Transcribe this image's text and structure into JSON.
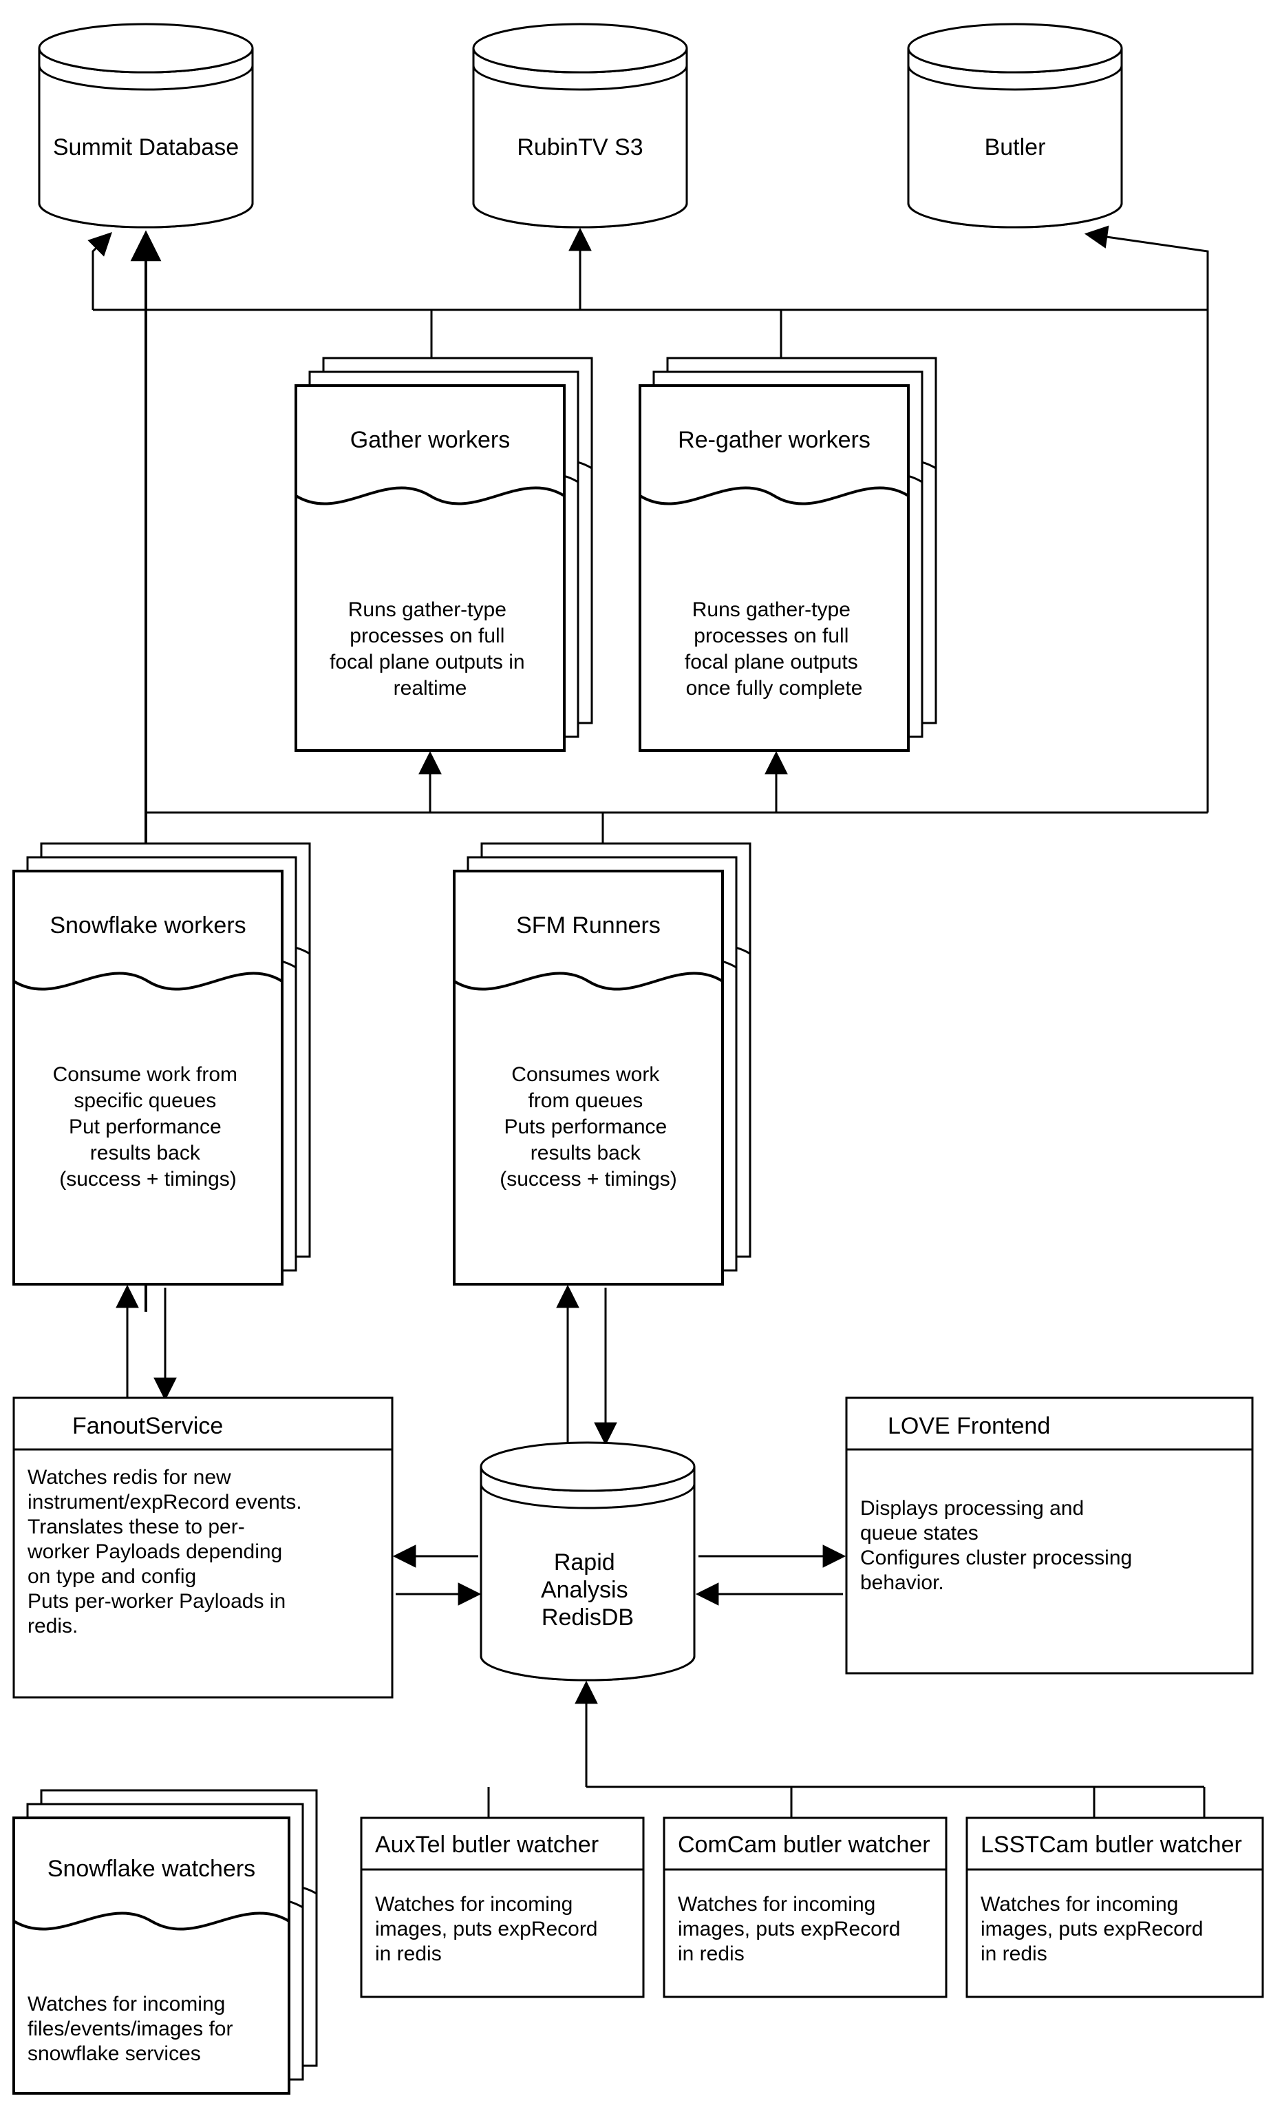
{
  "dbs": {
    "summit": "Summit Database",
    "rubin": "RubinTV S3",
    "butler": "Butler",
    "redis": [
      "Rapid",
      "Analysis",
      "RedisDB"
    ]
  },
  "stacks": {
    "gather": {
      "title": "Gather workers",
      "desc": [
        "Runs gather-type",
        "processes on full",
        "focal plane outputs in",
        "realtime"
      ]
    },
    "regather": {
      "title": "Re-gather workers",
      "desc": [
        "Runs gather-type",
        "processes on full",
        "focal plane outputs",
        "once fully complete"
      ]
    },
    "snowwork": {
      "title": "Snowflake workers",
      "desc": [
        "Consume work from",
        "specific queues",
        "",
        "Put performance",
        "results back",
        "(success + timings)"
      ]
    },
    "sfm": {
      "title": "SFM Runners",
      "desc": [
        "Consumes work",
        "from queues",
        "",
        "Puts performance",
        "results back",
        "(success + timings)"
      ]
    },
    "snowwatch": {
      "title": "Snowflake watchers",
      "desc": [
        "Watches for incoming",
        "files/events/images for",
        "snowflake services"
      ]
    }
  },
  "blocks": {
    "fanout": {
      "title": "FanoutService",
      "desc": [
        "Watches redis for new",
        "instrument/expRecord events.",
        "Translates these to per-",
        "worker Payloads depending",
        "on type and config",
        "",
        "Puts per-worker Payloads in",
        "redis."
      ]
    },
    "love": {
      "title": "LOVE Frontend",
      "desc": [
        "Displays processing and",
        "queue states",
        "",
        "Configures cluster processing",
        "behavior."
      ]
    },
    "auxtel": {
      "title": "AuxTel butler watcher",
      "desc": [
        "Watches for incoming",
        "images, puts expRecord",
        "in redis"
      ]
    },
    "comcam": {
      "title": "ComCam butler watcher",
      "desc": [
        "Watches for incoming",
        "images, puts expRecord",
        "in redis"
      ]
    },
    "lsstcam": {
      "title": "LSSTCam butler watcher",
      "desc": [
        "Watches for incoming",
        "images, puts expRecord",
        "in redis"
      ]
    }
  }
}
